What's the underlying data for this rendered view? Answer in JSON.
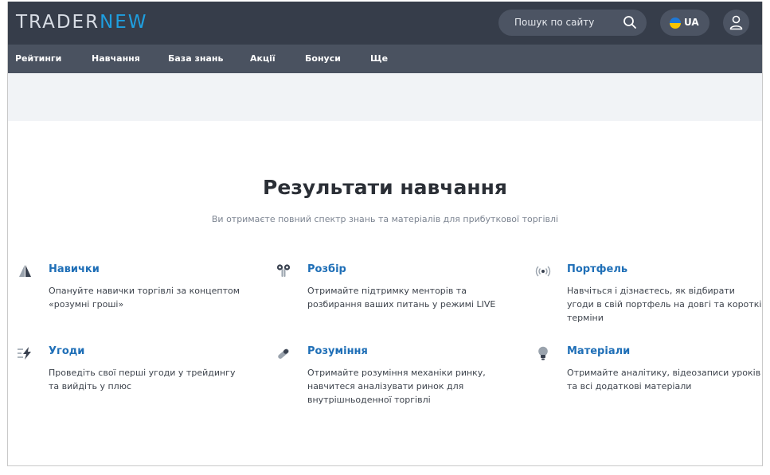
{
  "header": {
    "logo_part1": "TRADER",
    "logo_part2": "NEW",
    "search_placeholder": "Пошук по сайту",
    "language": "UA"
  },
  "nav": [
    "Рейтинги",
    "Навчання",
    "База знань",
    "Акції",
    "Бонуси",
    "Ще"
  ],
  "section": {
    "title": "Результати навчання",
    "subtitle": "Ви отримаєте повний спектр знань та матеріалів для прибуткової торгівлі"
  },
  "features": [
    {
      "icon": "sail-icon",
      "title": "Навички",
      "text": "Опануйте навички торгівлі за концептом «розумні гроші»"
    },
    {
      "icon": "earbuds-icon",
      "title": "Розбір",
      "text": "Отримайте підтримку менторів та розбирання ваших питань у режимі LIVE"
    },
    {
      "icon": "broadcast-icon",
      "title": "Портфель",
      "text": "Навчіться і дізнаєтесь, як відбирати угоди в свій портфель на довгі та короткі терміни"
    },
    {
      "icon": "lightning-icon",
      "title": "Угоди",
      "text": "Проведіть свої перші угоди у трейдингу та вийдіть у плюс"
    },
    {
      "icon": "band-aid-icon",
      "title": "Розуміння",
      "text": "Отримайте розуміння механіки ринку, навчитеся аналізувати ринок для внутрішньоденної торгівлі"
    },
    {
      "icon": "lightbulb-icon",
      "title": "Матеріали",
      "text": "Отримайте аналітику, відеозаписи уроків та всі додаткові матеріали"
    }
  ],
  "colors": {
    "header_bg": "#363d4a",
    "nav_bg": "#4a5260",
    "accent": "#1f6fb7",
    "logo_accent": "#1e9fe0"
  }
}
